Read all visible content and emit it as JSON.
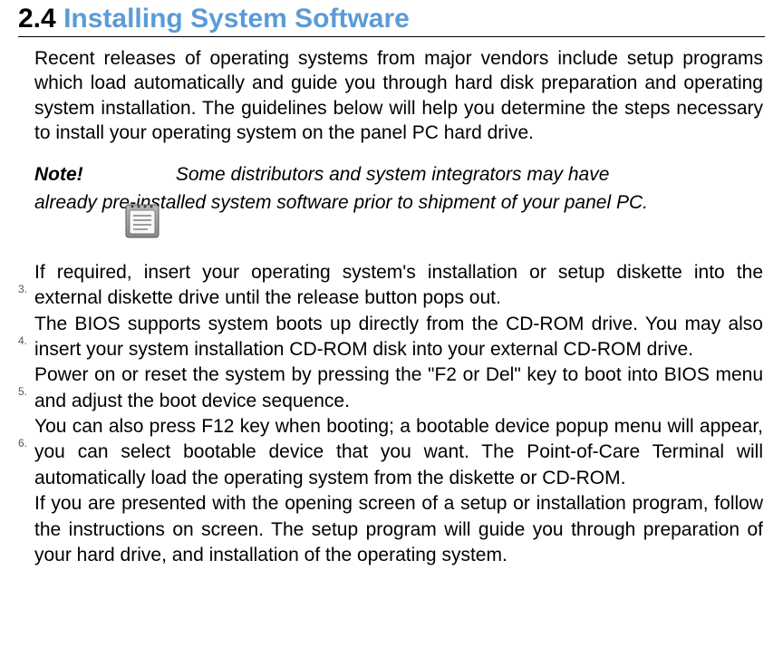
{
  "heading": {
    "number": "2.4",
    "title": "Installing System Software"
  },
  "intro": "Recent releases of operating systems from major vendors include setup programs which load automatically and guide you through hard disk preparation and operating system installation. The guidelines below will help you determine the steps necessary to install your operating system on the panel PC hard drive.",
  "note": {
    "label": "Note!",
    "line1": "Some distributors and system integrators may have",
    "line2": "already pre-installed system software prior to shipment of your panel PC."
  },
  "steps": [
    {
      "num": "3.",
      "text": "If required, insert your operating system's installation or setup diskette into the external diskette drive until the release button pops out."
    },
    {
      "num": "4.",
      "text": "The BIOS supports system boots up directly from the CD-ROM drive. You may also insert your system installation CD-ROM disk into your external CD-ROM drive."
    },
    {
      "num": "5.",
      "text": "Power on or reset the system by pressing the \"F2 or Del\" key to boot into BIOS menu and adjust the boot device sequence."
    },
    {
      "num": "6.",
      "text": "You can also press F12 key when booting; a bootable device popup menu will appear, you can select bootable device that you want. The Point-of-Care Terminal will automatically load the operating system from the diskette or CD-ROM."
    },
    {
      "num": "",
      "text": "If you are presented with the opening screen of a setup or installation program, follow the instructions on screen. The setup program will guide you through preparation of your hard drive, and installation of the operating system."
    }
  ]
}
